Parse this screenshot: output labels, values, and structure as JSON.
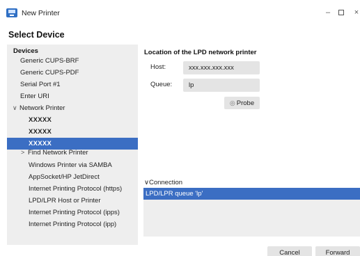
{
  "window": {
    "title": "New Printer",
    "icon": "printer-icon",
    "minimize": "–",
    "close": "×"
  },
  "page_heading": "Select Device",
  "devices": {
    "header": "Devices",
    "items": [
      {
        "label": "Generic CUPS-BRF"
      },
      {
        "label": "Generic CUPS-PDF"
      },
      {
        "label": "Serial Port #1"
      },
      {
        "label": "Enter URI"
      },
      {
        "label": "Network Printer",
        "expanded": true
      },
      {
        "label": "XXXXX"
      },
      {
        "label": "XXXXX"
      },
      {
        "label": "XXXXX",
        "selected": true
      },
      {
        "label": "Find Network Printer",
        "collapsed": true
      },
      {
        "label": "Windows Printer via SAMBA"
      },
      {
        "label": "AppSocket/HP JetDirect"
      },
      {
        "label": "Internet Printing Protocol (https)"
      },
      {
        "label": "LPD/LPR Host or Printer"
      },
      {
        "label": "Internet Printing Protocol (ipps)"
      },
      {
        "label": "Internet Printing Protocol (ipp)"
      }
    ],
    "expand_glyph": "∨",
    "collapse_glyph": ">"
  },
  "location": {
    "heading": "Location of the LPD network printer",
    "host_label": "Host:",
    "host_value": "xxx.xxx.xxx.xxx",
    "queue_label": "Queue:",
    "queue_value": "lp",
    "probe_label": "Probe",
    "probe_icon": "search-icon"
  },
  "connection": {
    "label": "Connection",
    "glyph": "∨",
    "options": [
      "LPD/LPR queue 'lp'"
    ]
  },
  "footer": {
    "cancel_label": "Cancel",
    "forward_label": "Forward"
  },
  "colors": {
    "selection": "#3b6ec3",
    "panel": "#eeeeee",
    "field": "#e4e4e4"
  }
}
